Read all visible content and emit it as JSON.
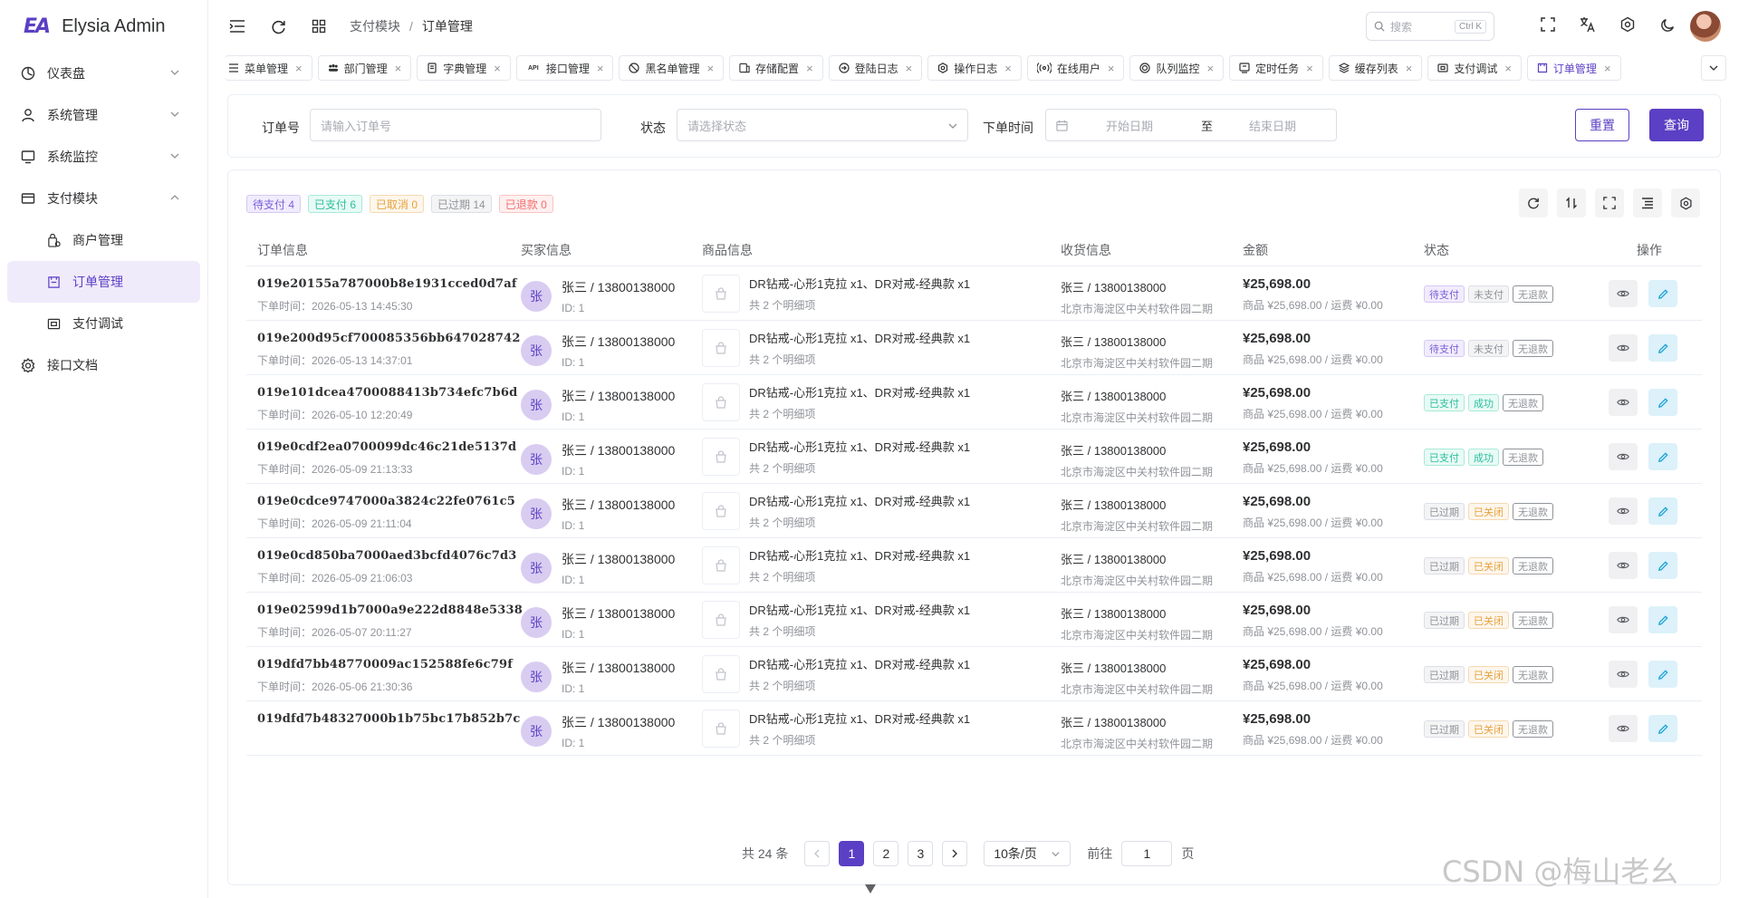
{
  "app": {
    "logo_mark": "EA",
    "title": "Elysia Admin"
  },
  "sidebar": {
    "items": [
      {
        "label": "仪表盘",
        "icon": "dashboard-icon"
      },
      {
        "label": "系统管理",
        "icon": "user-icon"
      },
      {
        "label": "系统监控",
        "icon": "monitor-icon"
      },
      {
        "label": "支付模块",
        "icon": "card-icon"
      }
    ],
    "sub_items": [
      {
        "label": "商户管理"
      },
      {
        "label": "订单管理"
      },
      {
        "label": "支付调试"
      }
    ],
    "doc_item": {
      "label": "接口文档"
    }
  },
  "header": {
    "breadcrumb": [
      "支付模块",
      "订单管理"
    ],
    "search_placeholder": "搜索",
    "search_kbd": "Ctrl K"
  },
  "tabs": [
    "菜单管理",
    "部门管理",
    "字典管理",
    "接口管理",
    "黑名单管理",
    "存储配置",
    "登陆日志",
    "操作日志",
    "在线用户",
    "队列监控",
    "定时任务",
    "缓存列表",
    "支付调试",
    "订单管理"
  ],
  "tab_api_prefix": "API",
  "filter": {
    "order_no_label": "订单号",
    "order_no_placeholder": "请输入订单号",
    "status_label": "状态",
    "status_placeholder": "请选择状态",
    "time_label": "下单时间",
    "start_placeholder": "开始日期",
    "range_sep": "至",
    "end_placeholder": "结束日期",
    "reset": "重置",
    "query": "查询"
  },
  "stats": [
    {
      "label": "待支付 4",
      "color": "#7b5fd6",
      "bg": "#f1ecfd",
      "border": "#d6c9f5"
    },
    {
      "label": "已支付 6",
      "color": "#2bbfa0",
      "bg": "#e8faf5",
      "border": "#a9ead8"
    },
    {
      "label": "已取消 0",
      "color": "#e6a23c",
      "bg": "#fdf6ec",
      "border": "#f5dab1"
    },
    {
      "label": "已过期 14",
      "color": "#909399",
      "bg": "#f4f4f5",
      "border": "#dcdfe6"
    },
    {
      "label": "已退款 0",
      "color": "#f56c6c",
      "bg": "#fef0f0",
      "border": "#fbc4c4"
    }
  ],
  "columns": [
    "订单信息",
    "买家信息",
    "商品信息",
    "收货信息",
    "金额",
    "状态",
    "操作"
  ],
  "rows": [
    {
      "order_no": "019e20155a787000b8e1931cced0d7af",
      "time": "下单时间：2026-05-13 14:45:30",
      "status": [
        "待支付",
        "未支付",
        "无退款"
      ],
      "kind": "pending"
    },
    {
      "order_no": "019e200d95cf700085356bb647028742",
      "time": "下单时间：2026-05-13 14:37:01",
      "status": [
        "待支付",
        "未支付",
        "无退款"
      ],
      "kind": "pending"
    },
    {
      "order_no": "019e101dcea4700088413b734efc7b6d",
      "time": "下单时间：2026-05-10 12:20:49",
      "status": [
        "已支付",
        "成功",
        "无退款"
      ],
      "kind": "paid"
    },
    {
      "order_no": "019e0cdf2ea0700099dc46c21de5137d",
      "time": "下单时间：2026-05-09 21:13:33",
      "status": [
        "已支付",
        "成功",
        "无退款"
      ],
      "kind": "paid"
    },
    {
      "order_no": "019e0cdce9747000a3824c22fe0761c5",
      "time": "下单时间：2026-05-09 21:11:04",
      "status": [
        "已过期",
        "已关闭",
        "无退款"
      ],
      "kind": "expired"
    },
    {
      "order_no": "019e0cd850ba7000aed3bcfd4076c7d3",
      "time": "下单时间：2026-05-09 21:06:03",
      "status": [
        "已过期",
        "已关闭",
        "无退款"
      ],
      "kind": "expired"
    },
    {
      "order_no": "019e02599d1b7000a9e222d8848e5338",
      "time": "下单时间：2026-05-07 20:11:27",
      "status": [
        "已过期",
        "已关闭",
        "无退款"
      ],
      "kind": "expired"
    },
    {
      "order_no": "019dfd7bb48770009ac152588fe6c79f",
      "time": "下单时间：2026-05-06 21:30:36",
      "status": [
        "已过期",
        "已关闭",
        "无退款"
      ],
      "kind": "expired"
    },
    {
      "order_no": "019dfd7b48327000b1b75bc17b852b7c",
      "time": "",
      "status": [
        "已过期",
        "已关闭",
        "无退款"
      ],
      "kind": "expired"
    }
  ],
  "row_common": {
    "buyer_avatar": "张",
    "buyer_name": "张三 / 13800138000",
    "buyer_id": "ID: 1",
    "goods_name": "DR钻戒-心形1克拉 x1、DR对戒-经典款 x1",
    "goods_sub": "共 2 个明细项",
    "addr_name": "张三 / 13800138000",
    "addr_detail": "北京市海淀区中关村软件园二期",
    "amount": "¥25,698.00",
    "amount_sub": "商品 ¥25,698.00 / 运费 ¥0.00"
  },
  "pagination": {
    "total": "共 24 条",
    "pages": [
      "1",
      "2",
      "3"
    ],
    "page_size": "10条/页",
    "goto": "前往",
    "goto_value": "1",
    "page_unit": "页"
  },
  "watermark": "CSDN @梅山老幺"
}
